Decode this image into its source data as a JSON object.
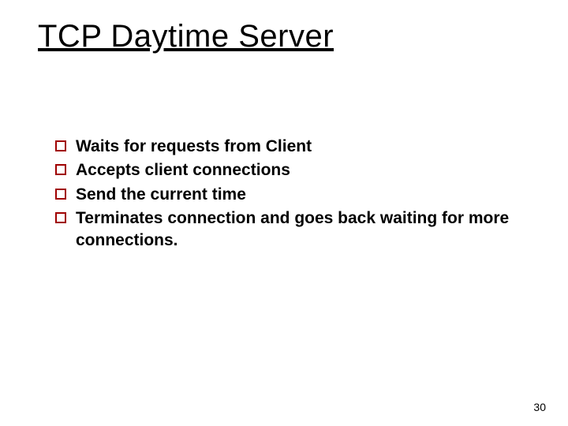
{
  "title": "TCP Daytime Server",
  "bullets": [
    "Waits for requests from Client",
    "Accepts client connections",
    "Send the current time",
    "Terminates connection and goes back waiting for more connections."
  ],
  "page_number": "30"
}
